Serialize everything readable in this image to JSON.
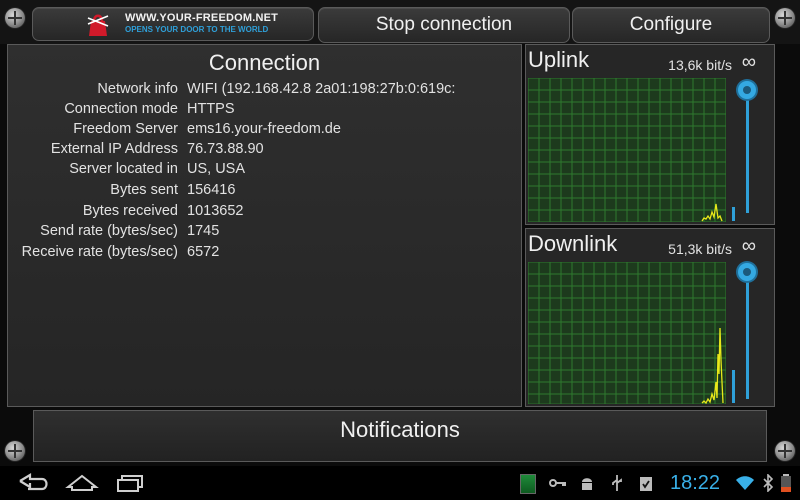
{
  "toolbar": {
    "logo_title": "WWW.YOUR-FREEDOM.NET",
    "logo_subtitle": "OPENS YOUR DOOR TO THE WORLD",
    "stop_label": "Stop connection",
    "configure_label": "Configure"
  },
  "connection": {
    "title": "Connection",
    "rows": [
      {
        "label": "Network info",
        "value": "WIFI (192.168.42.8 2a01:198:27b:0:619c:"
      },
      {
        "label": "Connection mode",
        "value": "HTTPS"
      },
      {
        "label": "Freedom Server",
        "value": "ems16.your-freedom.de"
      },
      {
        "label": "External IP Address",
        "value": "76.73.88.90"
      },
      {
        "label": "Server located in",
        "value": "US, USA"
      },
      {
        "label": "Bytes sent",
        "value": "156416"
      },
      {
        "label": "Bytes received",
        "value": "1013652"
      },
      {
        "label": "Send rate (bytes/sec)",
        "value": "1745"
      },
      {
        "label": "Receive rate (bytes/sec)",
        "value": "6572"
      }
    ]
  },
  "uplink": {
    "title": "Uplink",
    "rate": "13,6k bit/s",
    "limit": "∞",
    "slider_level": 1.0
  },
  "downlink": {
    "title": "Downlink",
    "rate": "51,3k bit/s",
    "limit": "∞",
    "slider_level": 1.0
  },
  "notifications": {
    "label": "Notifications"
  },
  "statusbar": {
    "time": "18:22",
    "icons": [
      "app-icon",
      "key-icon",
      "android-debug-icon",
      "usb-icon",
      "clipboard-icon",
      "wifi-icon",
      "bluetooth-icon",
      "battery-icon"
    ]
  },
  "colors": {
    "accent": "#2fa0d8",
    "grid": "#1f6a1f",
    "trace": "#e8e81a",
    "clock": "#39b0e8"
  }
}
